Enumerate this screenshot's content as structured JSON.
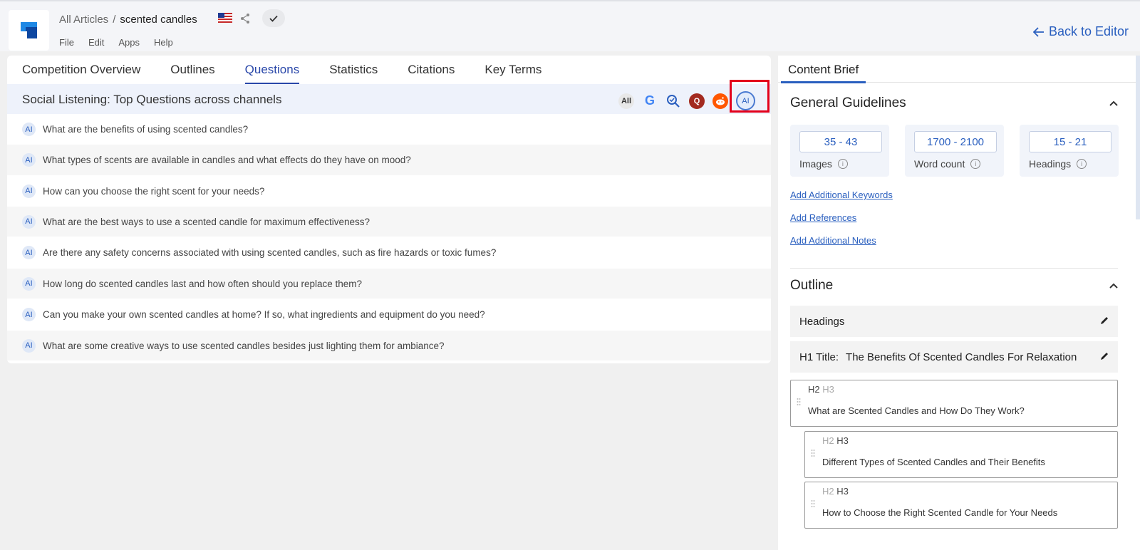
{
  "header": {
    "breadcrumb_root": "All Articles",
    "breadcrumb_sep": "/",
    "breadcrumb_current": "scented candles",
    "menu": [
      "File",
      "Edit",
      "Apps",
      "Help"
    ],
    "back_label": "Back to Editor"
  },
  "tabs": [
    "Competition Overview",
    "Outlines",
    "Questions",
    "Statistics",
    "Citations",
    "Key Terms"
  ],
  "active_tab": "Questions",
  "social": {
    "title": "Social Listening: Top Questions across channels",
    "chips": {
      "all": "All",
      "google": "G",
      "quora": "Q",
      "ai": "AI"
    }
  },
  "questions": [
    {
      "badge": "AI",
      "text": "What are the benefits of using scented candles?"
    },
    {
      "badge": "AI",
      "text": "What types of scents are available in candles and what effects do they have on mood?"
    },
    {
      "badge": "AI",
      "text": "How can you choose the right scent for your needs?"
    },
    {
      "badge": "AI",
      "text": "What are the best ways to use a scented candle for maximum effectiveness?"
    },
    {
      "badge": "AI",
      "text": "Are there any safety concerns associated with using scented candles, such as fire hazards or toxic fumes?"
    },
    {
      "badge": "AI",
      "text": "How long do scented candles last and how often should you replace them?"
    },
    {
      "badge": "AI",
      "text": "Can you make your own scented candles at home? If so, what ingredients and equipment do you need?"
    },
    {
      "badge": "AI",
      "text": "What are some creative ways to use scented candles besides just lighting them for ambiance?"
    }
  ],
  "brief": {
    "tab": "Content Brief",
    "general_title": "General Guidelines",
    "guidelines": [
      {
        "value": "35 - 43",
        "label": "Images"
      },
      {
        "value": "1700 - 2100",
        "label": "Word count"
      },
      {
        "value": "15 - 21",
        "label": "Headings"
      }
    ],
    "links": [
      "Add Additional Keywords",
      "Add References",
      "Add Additional Notes"
    ],
    "outline_title": "Outline",
    "headings_label": "Headings",
    "h1_label": "H1 Title:",
    "h1_value": "The Benefits Of Scented Candles For Relaxation",
    "h2_tag": "H2",
    "h3_tag": "H3",
    "outline_items": [
      {
        "level": "H2",
        "text": "What are Scented Candles and How Do They Work?"
      },
      {
        "level": "H3",
        "text": "Different Types of Scented Candles and Their Benefits"
      },
      {
        "level": "H3",
        "text": "How to Choose the Right Scented Candle for Your Needs"
      }
    ]
  },
  "colors": {
    "accent": "#2a5fbf",
    "highlight": "#e3001b"
  }
}
